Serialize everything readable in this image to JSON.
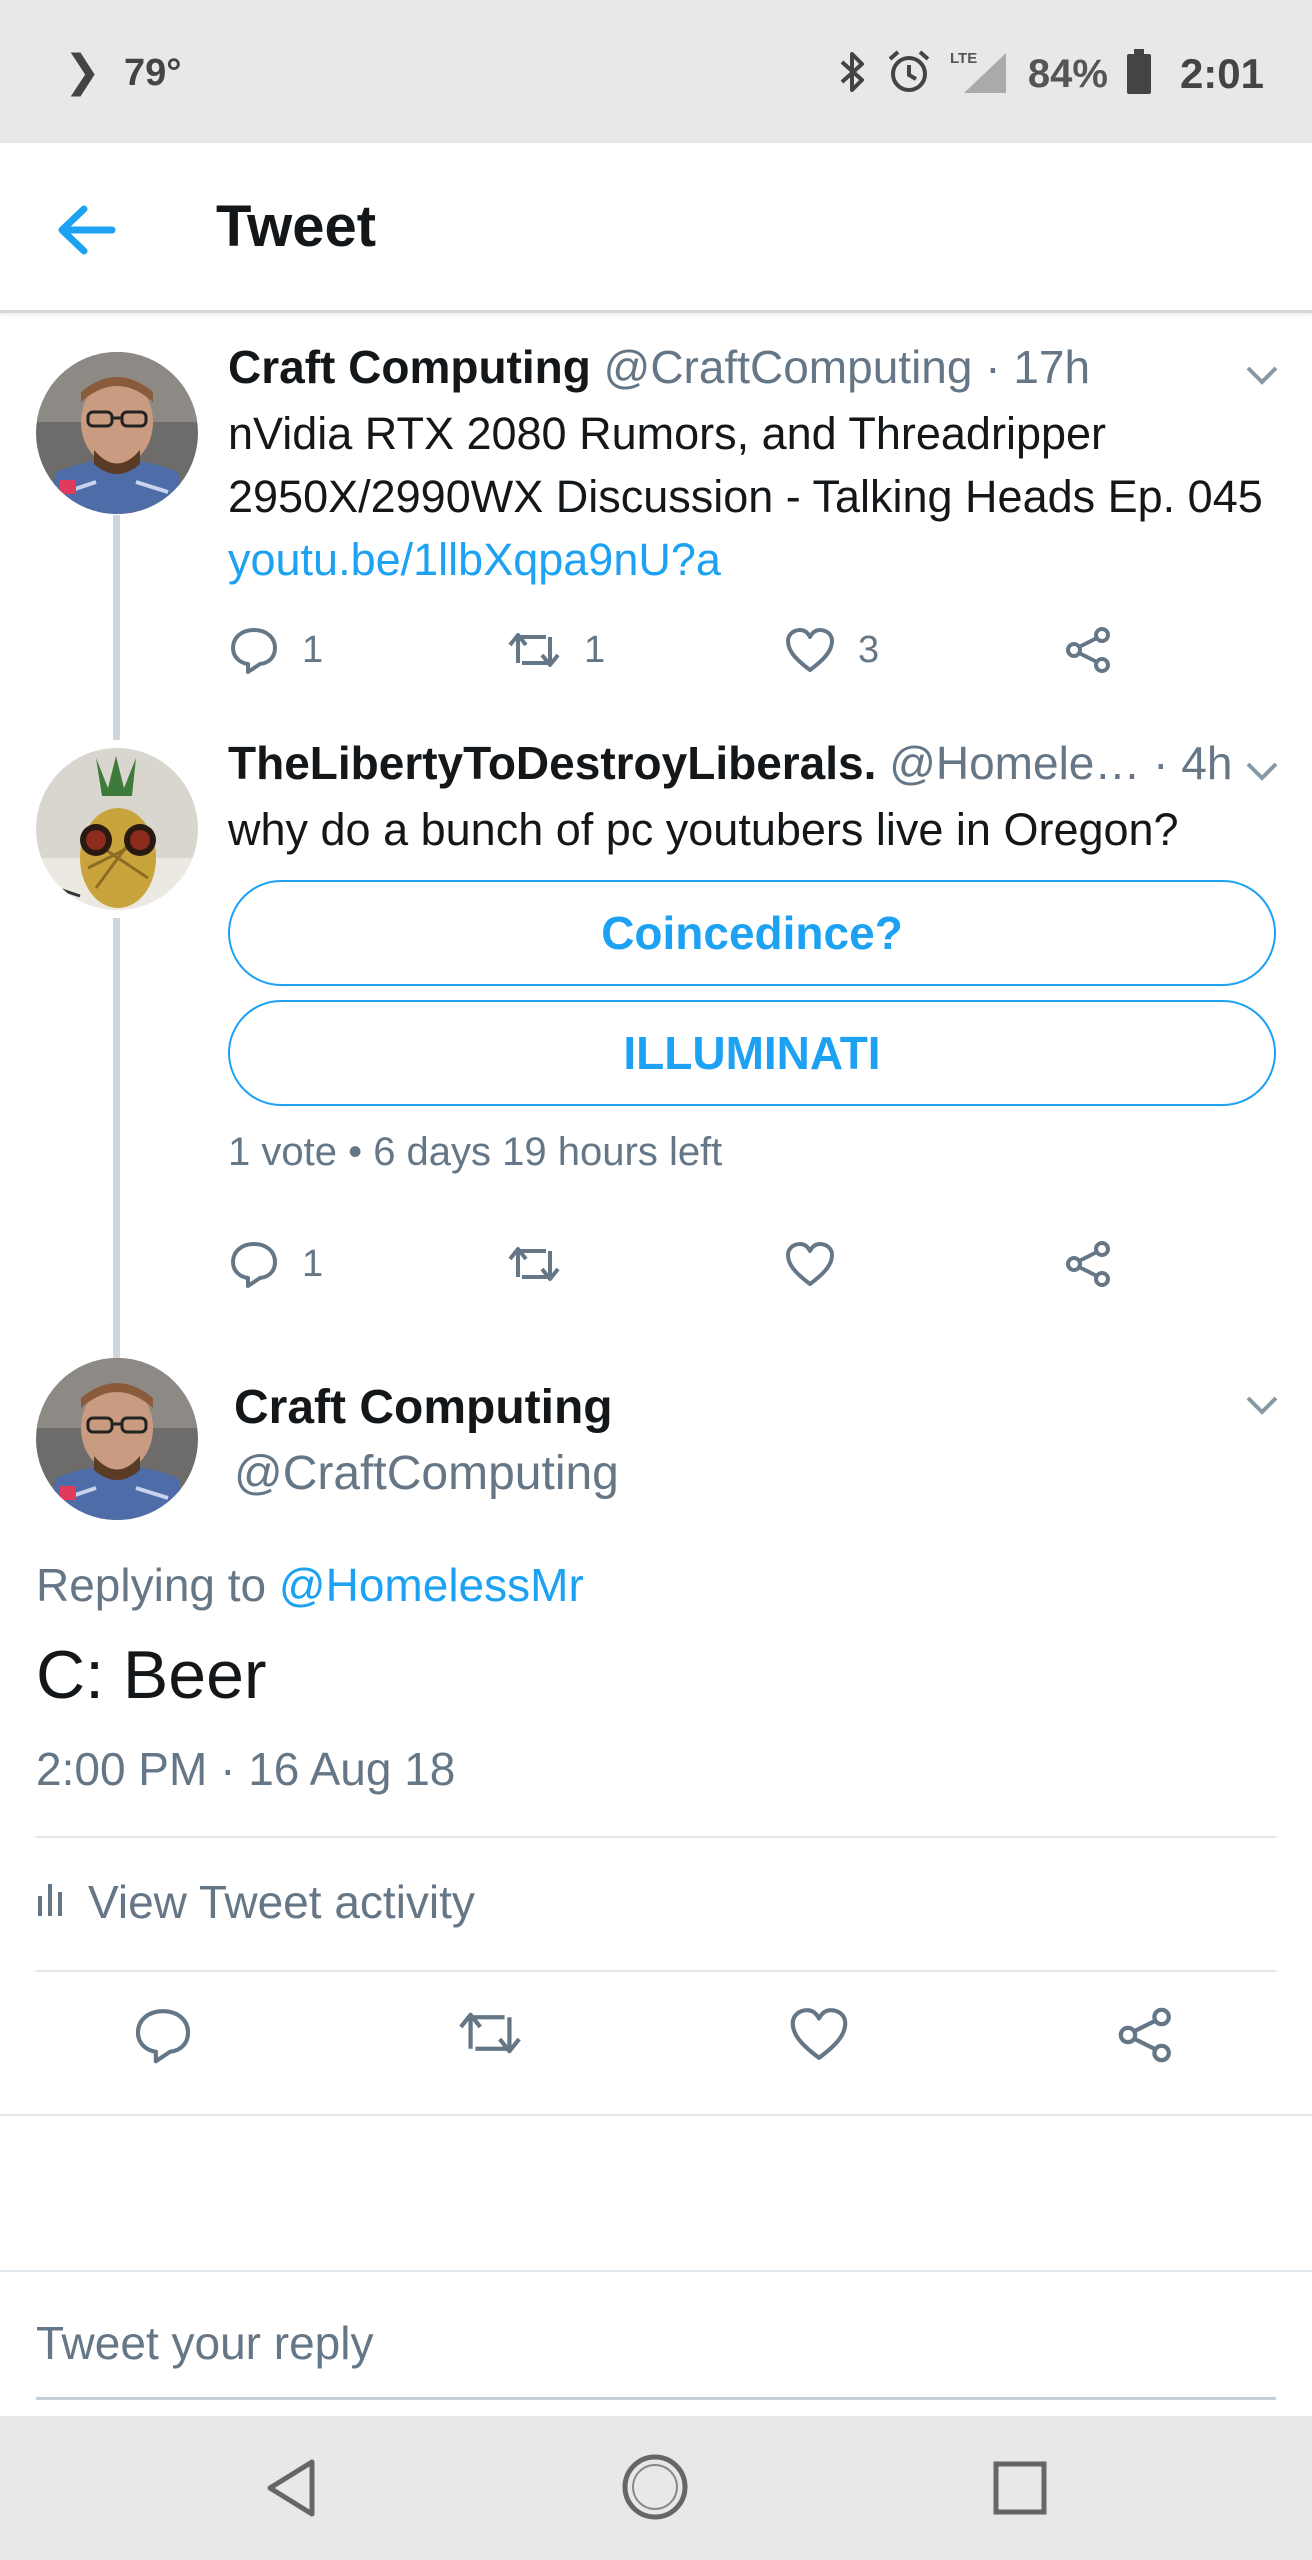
{
  "status_bar": {
    "temperature": "79°",
    "network": "LTE",
    "battery": "84%",
    "time": "2:01"
  },
  "header": {
    "title": "Tweet"
  },
  "thread": [
    {
      "name": "Craft Computing",
      "handle": "@CraftComputing · 17h",
      "text": "nVidia RTX 2080 Rumors, and Threadripper 2950X/2990WX Discussion - Talking Heads Ep. 045",
      "link": "youtu.be/1llbXqpa9nU?a",
      "replies": "1",
      "retweets": "1",
      "likes": "3"
    },
    {
      "name": "TheLibertyToDestroyLiberals.",
      "handle": "@Homele… · 4h",
      "text": "why do a bunch of pc youtubers live in Oregon?",
      "poll_options": [
        "Coincedince?",
        "ILLUMINATI"
      ],
      "poll_meta": "1 vote • 6 days 19 hours left",
      "replies": "1"
    }
  ],
  "main_tweet": {
    "name": "Craft Computing",
    "handle": "@CraftComputing",
    "replying_prefix": "Replying to ",
    "replying_to": "@HomelessMr",
    "text": "C: Beer",
    "timestamp": "2:00 PM · 16 Aug 18",
    "activity_label": "View Tweet activity"
  },
  "reply": {
    "placeholder": "Tweet your reply"
  },
  "colors": {
    "accent": "#1da1f2",
    "muted": "#657786",
    "text": "#14171a"
  }
}
